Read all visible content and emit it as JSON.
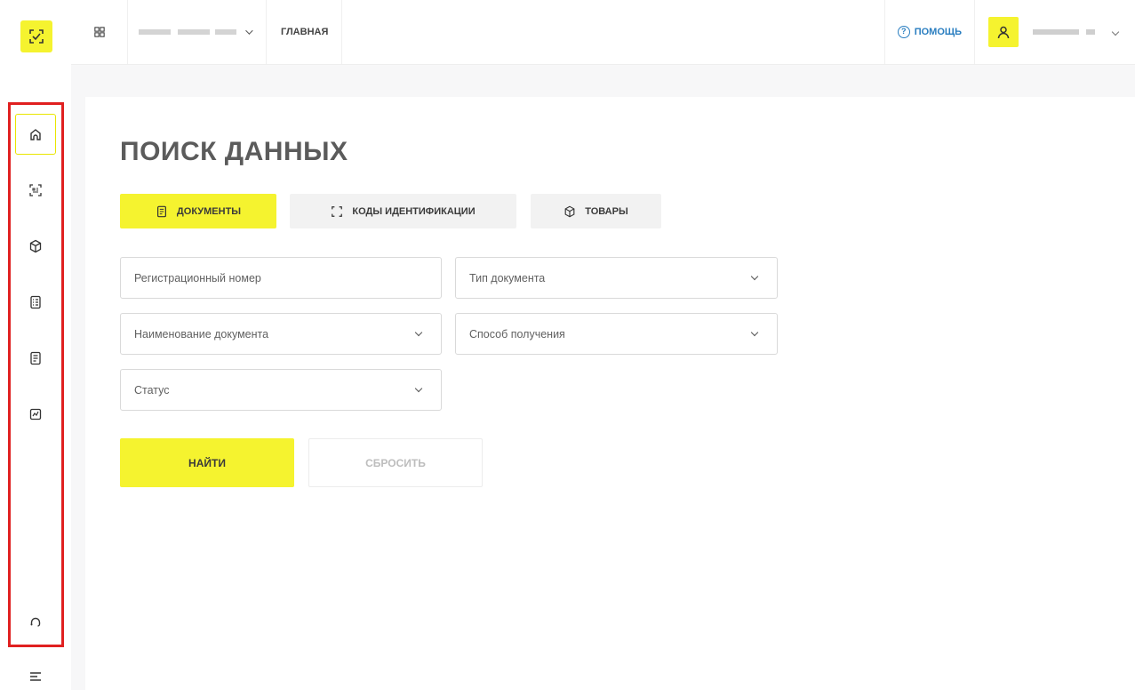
{
  "topbar": {
    "apps_icon": "grid-icon",
    "org_name": "",
    "home_label": "ГЛАВНАЯ",
    "help_label": "ПОМОЩЬ",
    "user_name": ""
  },
  "sidebar": {
    "items": [
      {
        "name": "home",
        "icon": "home-icon",
        "active": true
      },
      {
        "name": "codes",
        "icon": "scan-code-icon"
      },
      {
        "name": "goods",
        "icon": "box-icon"
      },
      {
        "name": "registry",
        "icon": "list-icon"
      },
      {
        "name": "documents",
        "icon": "document-icon"
      },
      {
        "name": "reports",
        "icon": "chart-icon"
      }
    ],
    "support_icon": "headset-icon",
    "menu_icon": "hamburger-icon"
  },
  "main": {
    "title": "ПОИСК ДАННЫХ",
    "tabs": [
      {
        "label": "ДОКУМЕНТЫ",
        "active": true
      },
      {
        "label": "КОДЫ ИДЕНТИФИКАЦИИ",
        "active": false
      },
      {
        "label": "ТОВАРЫ",
        "active": false
      }
    ],
    "fields": {
      "reg_number_placeholder": "Регистрационный номер",
      "doc_type_placeholder": "Тип документа",
      "doc_name_placeholder": "Наименование документа",
      "receive_method_placeholder": "Способ получения",
      "status_placeholder": "Статус"
    },
    "buttons": {
      "find": "НАЙТИ",
      "reset": "СБРОСИТЬ"
    }
  },
  "colors": {
    "accent": "#f5f32f",
    "help_link": "#2a7ec0",
    "highlight_box": "#e02020"
  }
}
